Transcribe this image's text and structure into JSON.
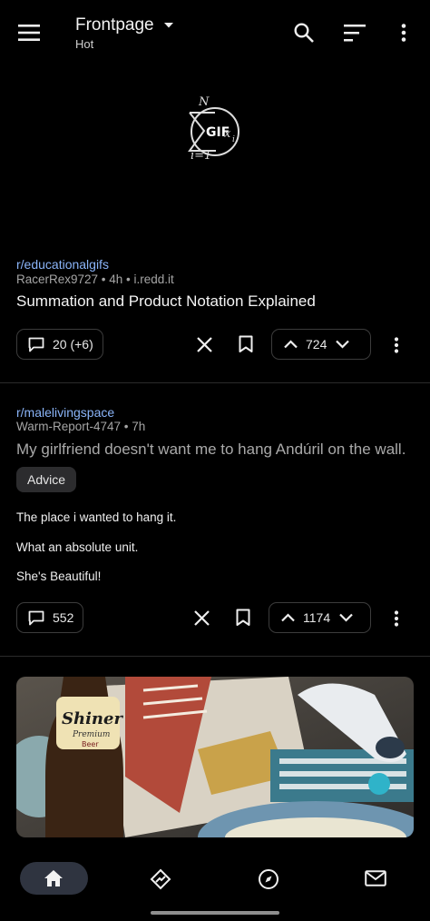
{
  "header": {
    "feed_title": "Frontpage",
    "sort_label": "Hot",
    "menu_icon": "menu-icon",
    "search_icon": "search-icon",
    "sort_icon": "sort-icon",
    "overflow_icon": "more-vert-icon"
  },
  "posts": [
    {
      "subreddit": "r/educationalgifs",
      "meta": "RacerRex9727 • 4h • i.redd.it",
      "title": "Summation and Product Notation Explained",
      "comments": "20 (+6)",
      "score": "724",
      "gif_badge": "GIF",
      "math": {
        "top": "N",
        "bottom": "i=1",
        "var": "x",
        "sub": "i"
      }
    },
    {
      "subreddit": "r/malelivingspace",
      "meta": "Warm-Report-4747 • 7h",
      "title": "My girlfriend doesn't want me to hang Andúril on the wall.",
      "flair": "Advice",
      "body": [
        "The place i wanted to hang it.",
        "What an absolute unit.",
        "She's Beautiful!"
      ],
      "comments": "552",
      "score": "1174"
    },
    {
      "image_text": {
        "brand": "Shiner",
        "sub": "Premium",
        "tag": "Beer"
      }
    }
  ],
  "bottom_nav": [
    {
      "icon": "home-icon",
      "active": true
    },
    {
      "icon": "popular-icon",
      "active": false
    },
    {
      "icon": "explore-icon",
      "active": false
    },
    {
      "icon": "inbox-icon",
      "active": false
    }
  ],
  "colors": {
    "background": "#000000",
    "subreddit_link": "#8ab4f8",
    "active_tab": "#2f3440"
  }
}
